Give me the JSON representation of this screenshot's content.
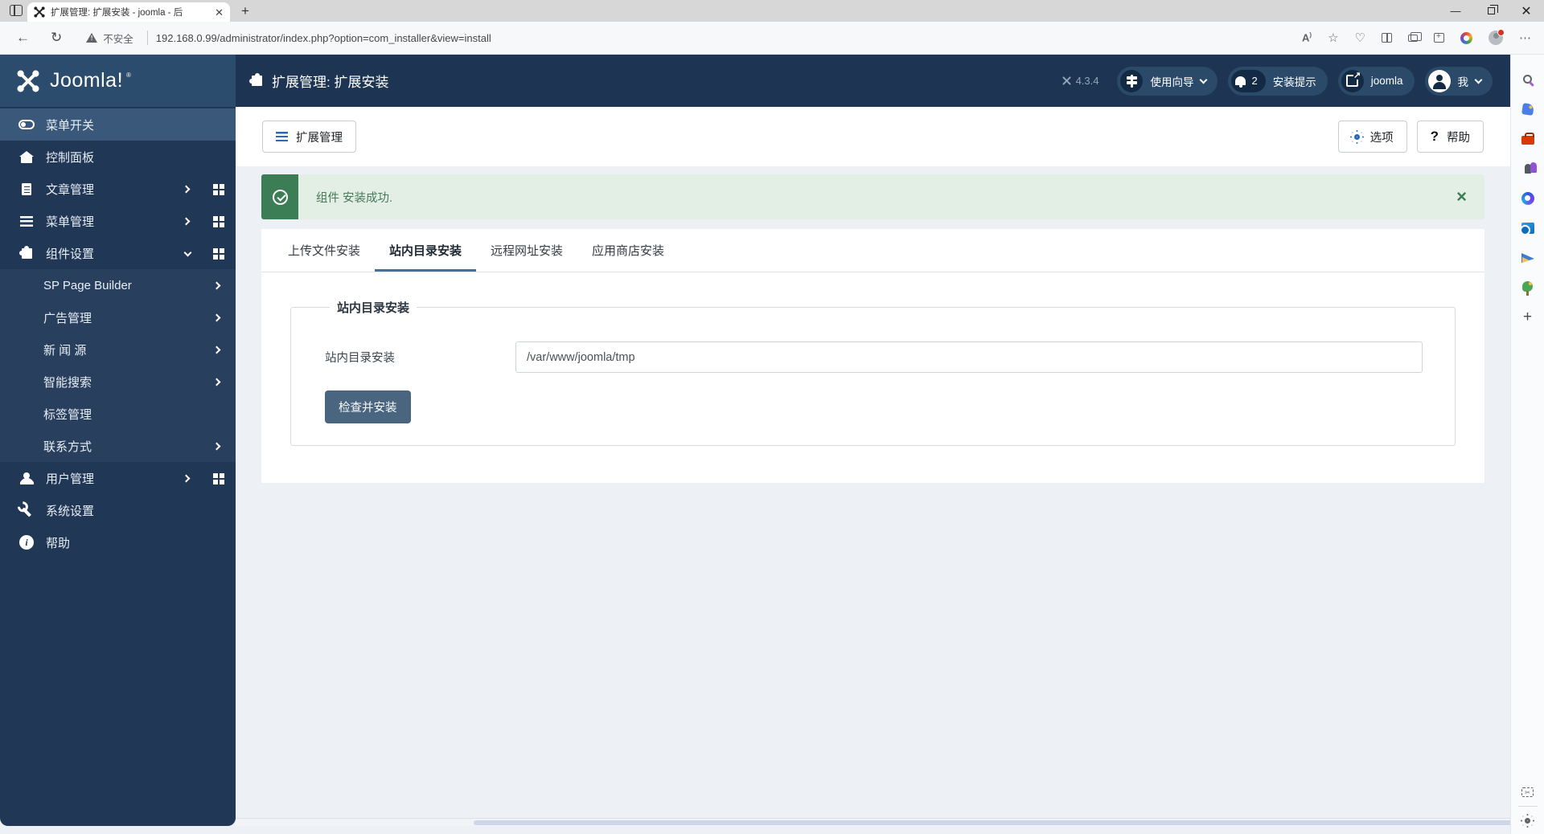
{
  "browser": {
    "tab_title": "扩展管理: 扩展安装 - joomla - 后",
    "security_label": "不安全",
    "url": "192.168.0.99/administrator/index.php?option=com_installer&view=install"
  },
  "joomla": {
    "logo_text": "Joomla!",
    "page_title": "扩展管理: 扩展安装",
    "version": "4.3.4",
    "pills": [
      {
        "label": "使用向导"
      },
      {
        "label": "安装提示",
        "badge": "2"
      },
      {
        "label": "joomla"
      },
      {
        "label": "我"
      }
    ]
  },
  "sidebar": {
    "items": [
      {
        "label": "菜单开关"
      },
      {
        "label": "控制面板"
      },
      {
        "label": "文章管理"
      },
      {
        "label": "菜单管理"
      },
      {
        "label": "组件设置"
      },
      {
        "label": "SP Page Builder"
      },
      {
        "label": "广告管理"
      },
      {
        "label": "新 闻 源"
      },
      {
        "label": "智能搜索"
      },
      {
        "label": "标签管理"
      },
      {
        "label": "联系方式"
      },
      {
        "label": "用户管理"
      },
      {
        "label": "系统设置"
      },
      {
        "label": "帮助"
      }
    ]
  },
  "content": {
    "toolbar": {
      "manage_label": "扩展管理",
      "options_label": "选项",
      "help_label": "帮助"
    },
    "alert": {
      "message": "组件 安装成功."
    },
    "tabs": [
      {
        "label": "上传文件安装"
      },
      {
        "label": "站内目录安装"
      },
      {
        "label": "远程网址安装"
      },
      {
        "label": "应用商店安装"
      }
    ],
    "form": {
      "legend": "站内目录安装",
      "field_label": "站内目录安装",
      "field_value": "/var/www/joomla/tmp",
      "submit_label": "检查并安装"
    }
  },
  "icons": {
    "joomla_logo": "joomla-x-mark",
    "page_title_icon": "puzzle-piece",
    "guide_pill": "signpost",
    "notifications_pill": "bell",
    "site_pill": "external-link",
    "user_pill": "person-circle",
    "options_button": "gear",
    "help_button": "question-mark",
    "alert_icon": "check-circle",
    "edge_rail": [
      "search",
      "shopping-tag",
      "toolbox",
      "games",
      "microsoft-365",
      "outlook",
      "drop",
      "grow",
      "add",
      "screenshot",
      "settings-gear"
    ]
  },
  "colors": {
    "header_bg": "#1d3452",
    "logo_bg": "#2c4c6e",
    "sidebar_bg": "#203756",
    "sidebar_active_bg": "#3a587a",
    "submenu_bg": "#28405e",
    "accent_blue": "#2a69b8",
    "success_green": "#3b7d55",
    "success_bg": "#e3efe5",
    "tab_underline": "#4a6f94",
    "primary_button_bg": "#4a6580",
    "content_bg": "#edf0f4"
  }
}
